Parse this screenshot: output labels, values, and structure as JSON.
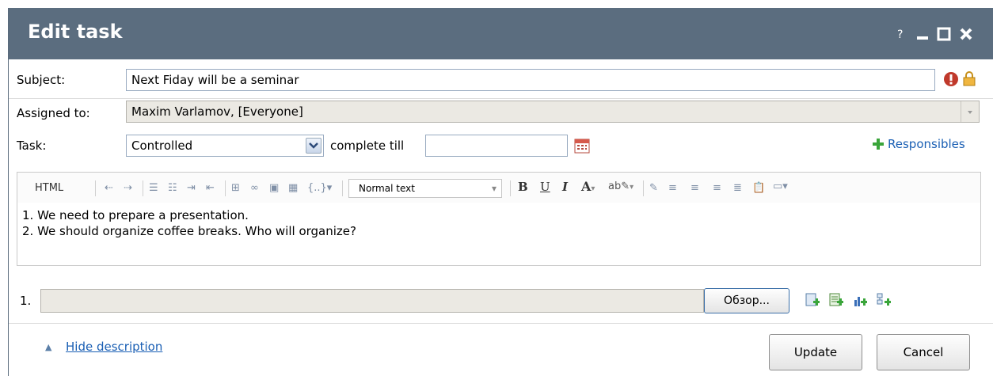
{
  "window": {
    "title": "Edit task",
    "help": "?"
  },
  "form": {
    "subject_label": "Subject:",
    "subject_value": "Next Fiday will be a seminar",
    "assigned_label": "Assigned to:",
    "assigned_value": "Maxim Varlamov, [Everyone]",
    "task_label": "Task:",
    "task_type": "Controlled",
    "complete_till_label": "complete till",
    "complete_till_value": "",
    "responsibles_link": "Responsibles"
  },
  "editor": {
    "html_button": "HTML",
    "style_select": "Normal text",
    "lines": [
      "1. We need to prepare a presentation.",
      "2. We should organize coffee breaks. Who will organize?"
    ]
  },
  "attachments": {
    "index": "1.",
    "browse_button": "Обзор..."
  },
  "footer": {
    "hide_description": "Hide description",
    "update_button": "Update",
    "cancel_button": "Cancel"
  },
  "colors": {
    "title_bar": "#5b6d7f",
    "link": "#1a5fb4"
  }
}
